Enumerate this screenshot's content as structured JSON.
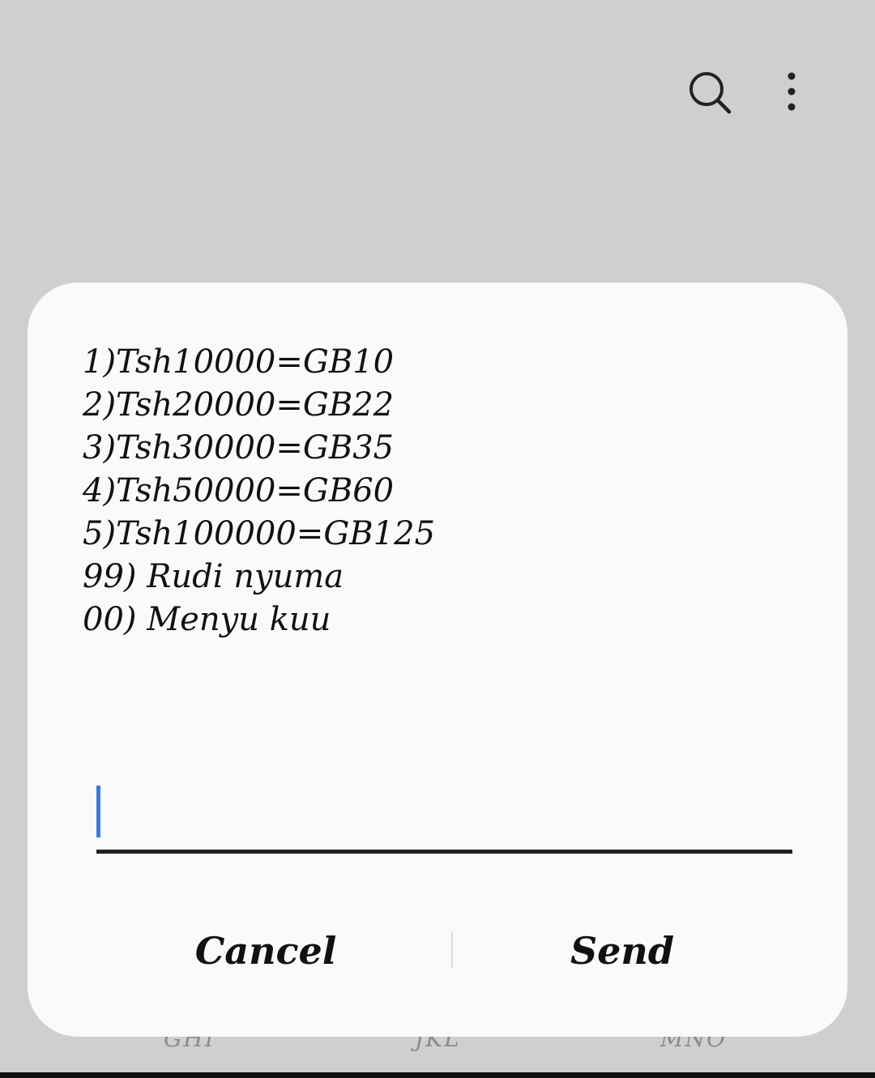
{
  "header": {
    "icons": [
      "search-icon",
      "more-vertical-icon"
    ]
  },
  "background_keys": [
    "GHI",
    "JKL",
    "MNO"
  ],
  "dialog": {
    "message_lines": [
      "1)Tsh10000=GB10",
      "2)Tsh20000=GB22",
      "3)Tsh30000=GB35",
      "4)Tsh50000=GB60",
      "5)Tsh100000=GB125",
      "99) Rudi nyuma",
      "00) Menyu kuu"
    ],
    "input": {
      "value": "",
      "placeholder": ""
    },
    "cancel_label": "Cancel",
    "send_label": "Send"
  },
  "colors": {
    "background": "#cfcfd1",
    "dialog": "#f9fafc",
    "caret": "#3a7bd5",
    "text": "#111111"
  }
}
